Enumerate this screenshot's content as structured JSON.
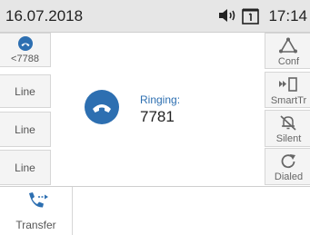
{
  "status_bar": {
    "date": "16.07.2018",
    "time": "17:14"
  },
  "left_keys": [
    {
      "label": "<7788",
      "icon": "call-ringing-icon"
    },
    {
      "label": "Line"
    },
    {
      "label": "Line"
    },
    {
      "label": "Line"
    }
  ],
  "call": {
    "status": "Ringing:",
    "number": "7781",
    "icon": "ringing-phone-icon"
  },
  "right_keys": [
    {
      "label": "Conf",
      "icon": "conference-icon"
    },
    {
      "label": "SmartTr",
      "icon": "smart-transfer-icon"
    },
    {
      "label": "Silent",
      "icon": "silent-bell-icon"
    },
    {
      "label": "Dialed",
      "icon": "redial-icon"
    }
  ],
  "bottom": {
    "transfer_label": "Transfer",
    "icon": "transfer-icon"
  },
  "colors": {
    "accent": "#2d6fb1",
    "status_bar": "#e6e6e6"
  }
}
